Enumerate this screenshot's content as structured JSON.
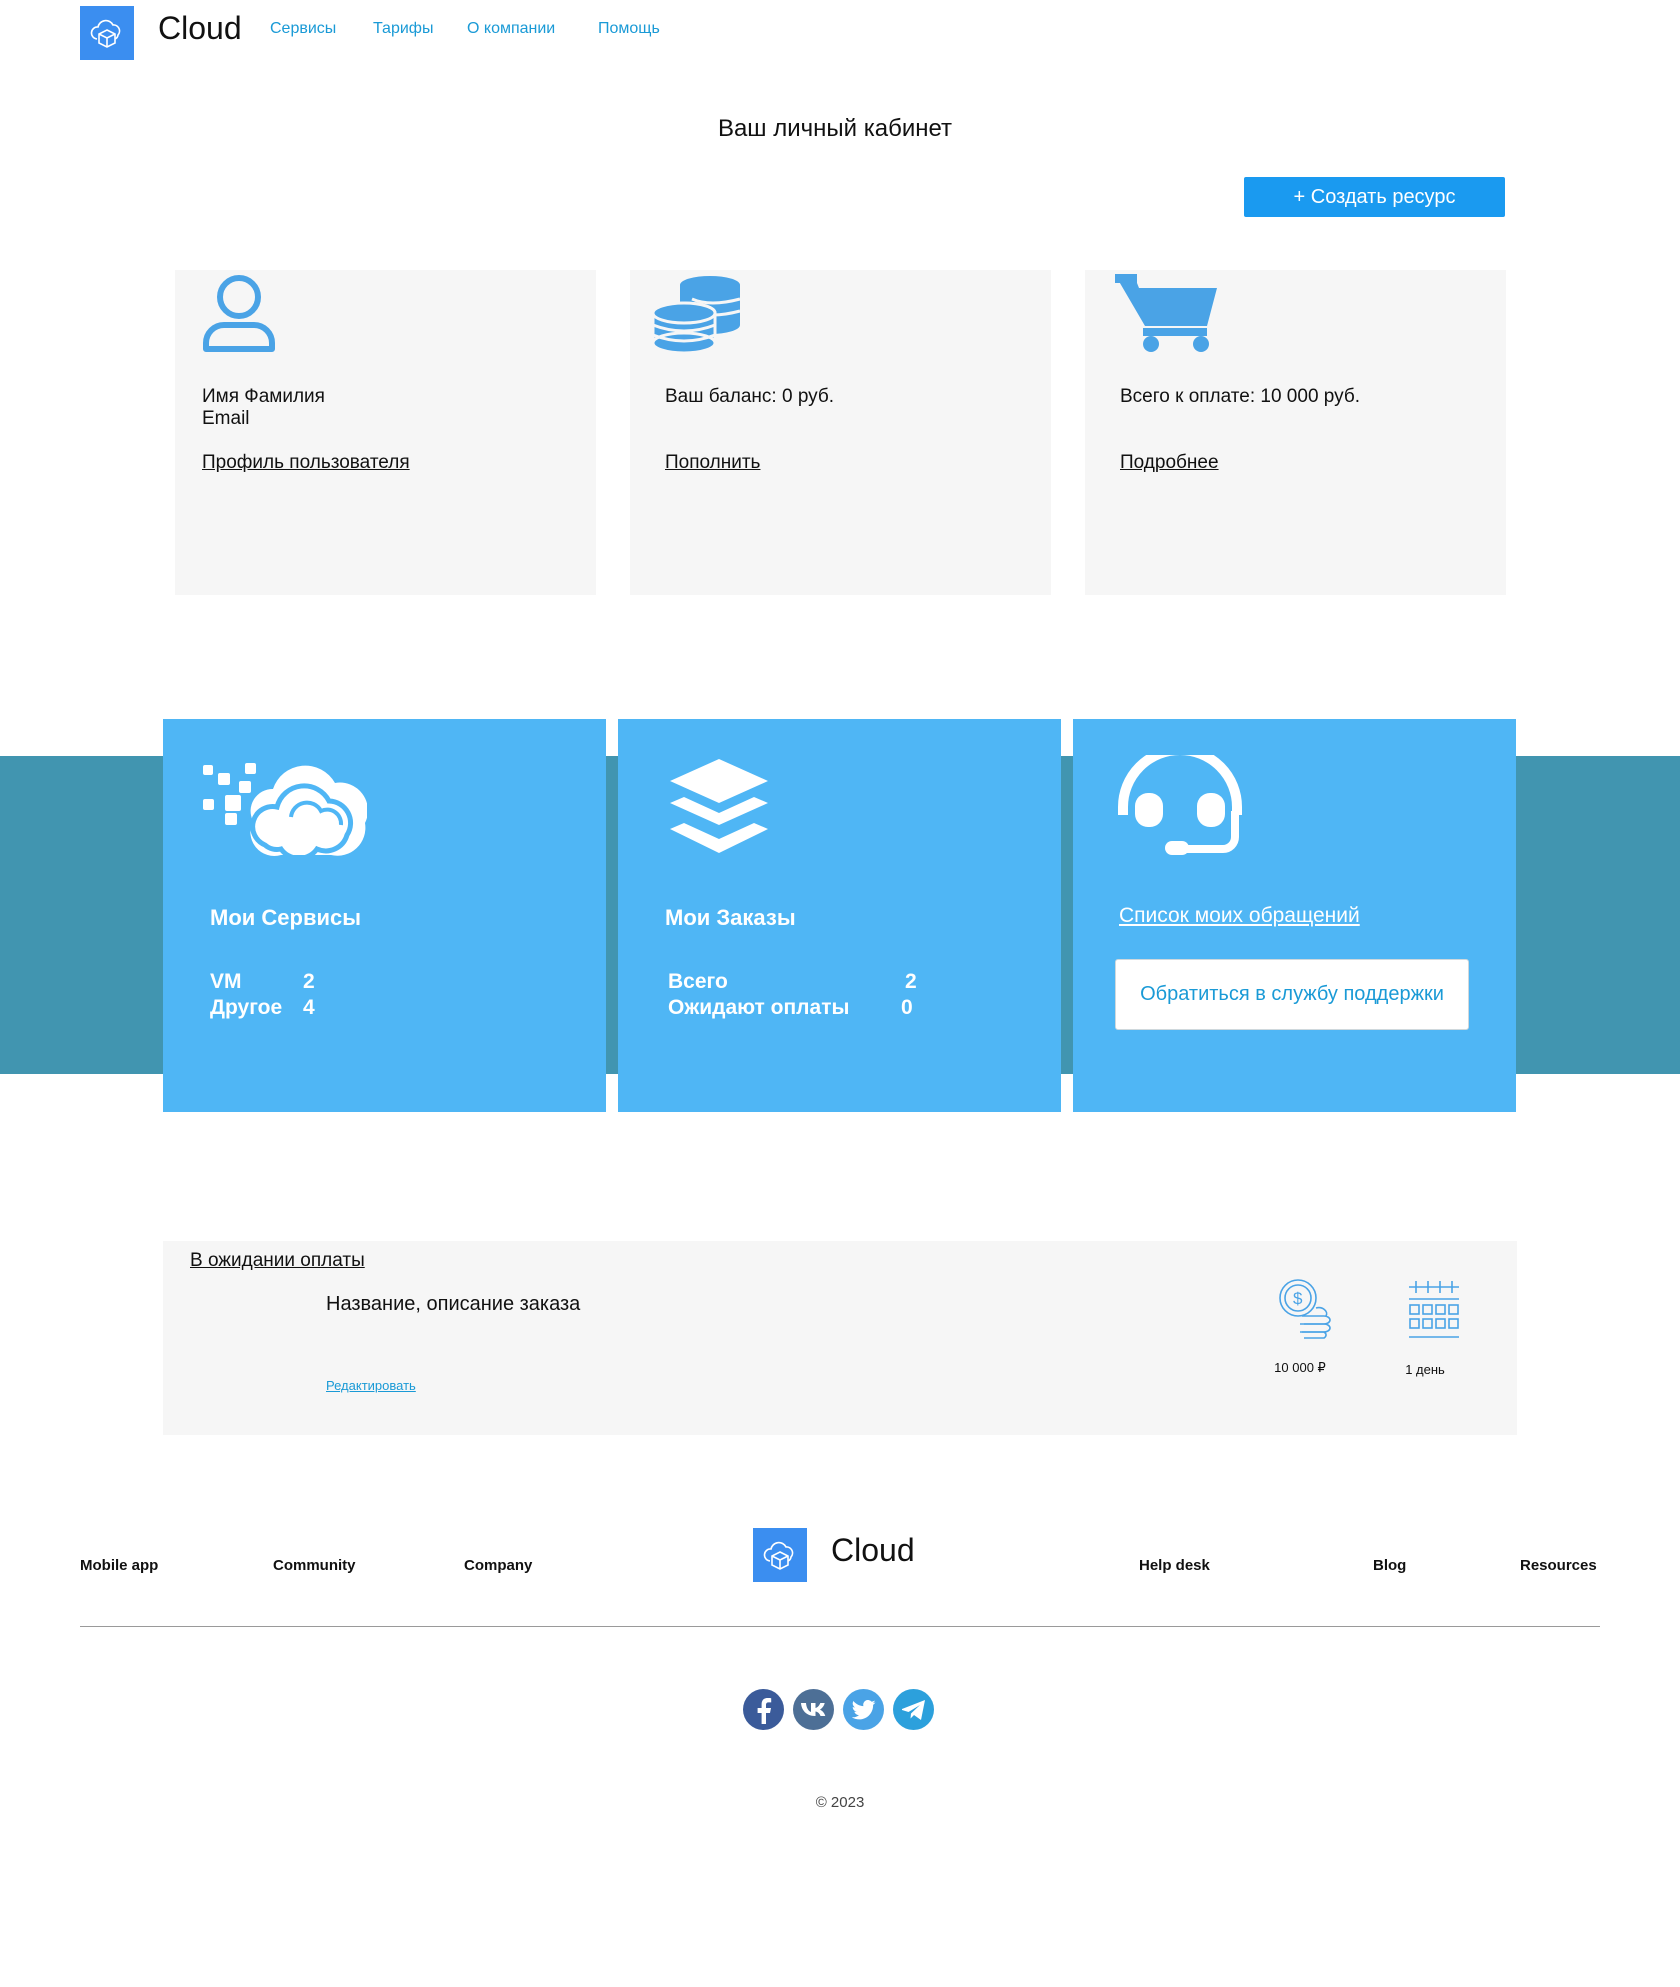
{
  "header": {
    "brand": "Cloud",
    "nav": [
      "Сервисы",
      "Тарифы",
      "О компании",
      "Помощь"
    ]
  },
  "page_title": "Ваш личный кабинет",
  "create_button": "+ Создать ресурс",
  "cards": {
    "profile": {
      "name": "Имя Фамилия",
      "email": "Email",
      "link": "Профиль пользователя"
    },
    "balance": {
      "text": "Ваш баланс: 0 руб.",
      "link": "Пополнить"
    },
    "payment": {
      "text": "Всего к оплате: 10 000 руб.",
      "link": "Подробнее"
    }
  },
  "services": {
    "title": "Мои Сервисы",
    "rows": [
      {
        "label": "VM",
        "value": "2"
      },
      {
        "label": "Другое",
        "value": "4"
      }
    ]
  },
  "orders": {
    "title": "Мои Заказы",
    "rows": [
      {
        "label": "Всего",
        "value": "2"
      },
      {
        "label": "Ожидают оплаты",
        "value": "0"
      }
    ]
  },
  "support": {
    "link": "Список моих обращений",
    "button": "Обратиться в службу поддержки"
  },
  "pending": {
    "heading": "В ожидании оплаты",
    "description": "Название, описание заказа",
    "edit": "Редактировать",
    "price": "10 000 ₽",
    "duration": "1 день"
  },
  "footer": {
    "links_left": [
      "Mobile app",
      "Community",
      "Company"
    ],
    "brand": "Cloud",
    "links_right": [
      "Help desk",
      "Blog",
      "Resources"
    ],
    "social": [
      "facebook-icon",
      "vk-icon",
      "twitter-icon",
      "telegram-icon"
    ],
    "copyright": "© 2023"
  },
  "colors": {
    "brand_blue": "#3b8ef0",
    "card_blue": "#4fb6f5",
    "band_teal": "#4195b0",
    "link_blue": "#1a9ad6"
  }
}
